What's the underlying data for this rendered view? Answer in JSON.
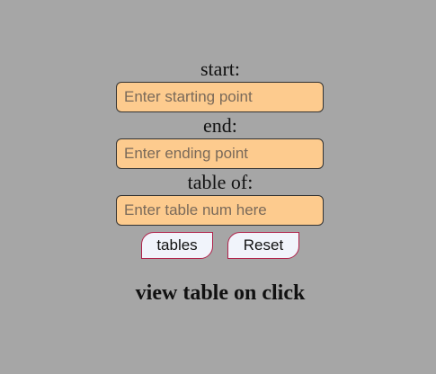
{
  "form": {
    "start": {
      "label": "start:",
      "placeholder": "Enter starting point",
      "value": ""
    },
    "end": {
      "label": "end:",
      "placeholder": "Enter ending point",
      "value": ""
    },
    "table_of": {
      "label": "table of:",
      "placeholder": "Enter table num here",
      "value": ""
    }
  },
  "buttons": {
    "tables_label": "tables",
    "reset_label": "Reset"
  },
  "output": {
    "message": "view table on click"
  },
  "colors": {
    "background": "#a6a6a6",
    "input_fill": "#fdcb8e",
    "button_fill": "#f1f4fb",
    "button_border": "#b0224a"
  }
}
